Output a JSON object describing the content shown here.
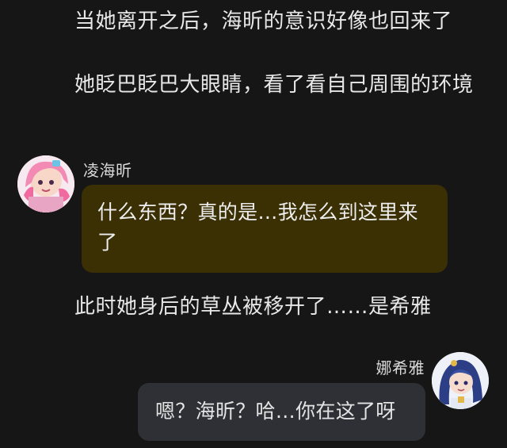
{
  "narration": [
    "当她离开之后，海昕的意识好像也回来了",
    "她眨巴眨巴大眼睛，看了看自己周围的环境",
    "此时她身后的草丛被移开了……是希雅"
  ],
  "messages": [
    {
      "sender": "凌海昕",
      "side": "left",
      "text": "什么东西？真的是…我怎么到这里来了",
      "bubble_color": "#3b2f04"
    },
    {
      "sender": "娜希雅",
      "side": "right",
      "text": "嗯？海昕？哈…你在这了呀",
      "bubble_color": "#2e3035"
    }
  ],
  "colors": {
    "background": "#161616",
    "text": "#e8e8e8"
  }
}
